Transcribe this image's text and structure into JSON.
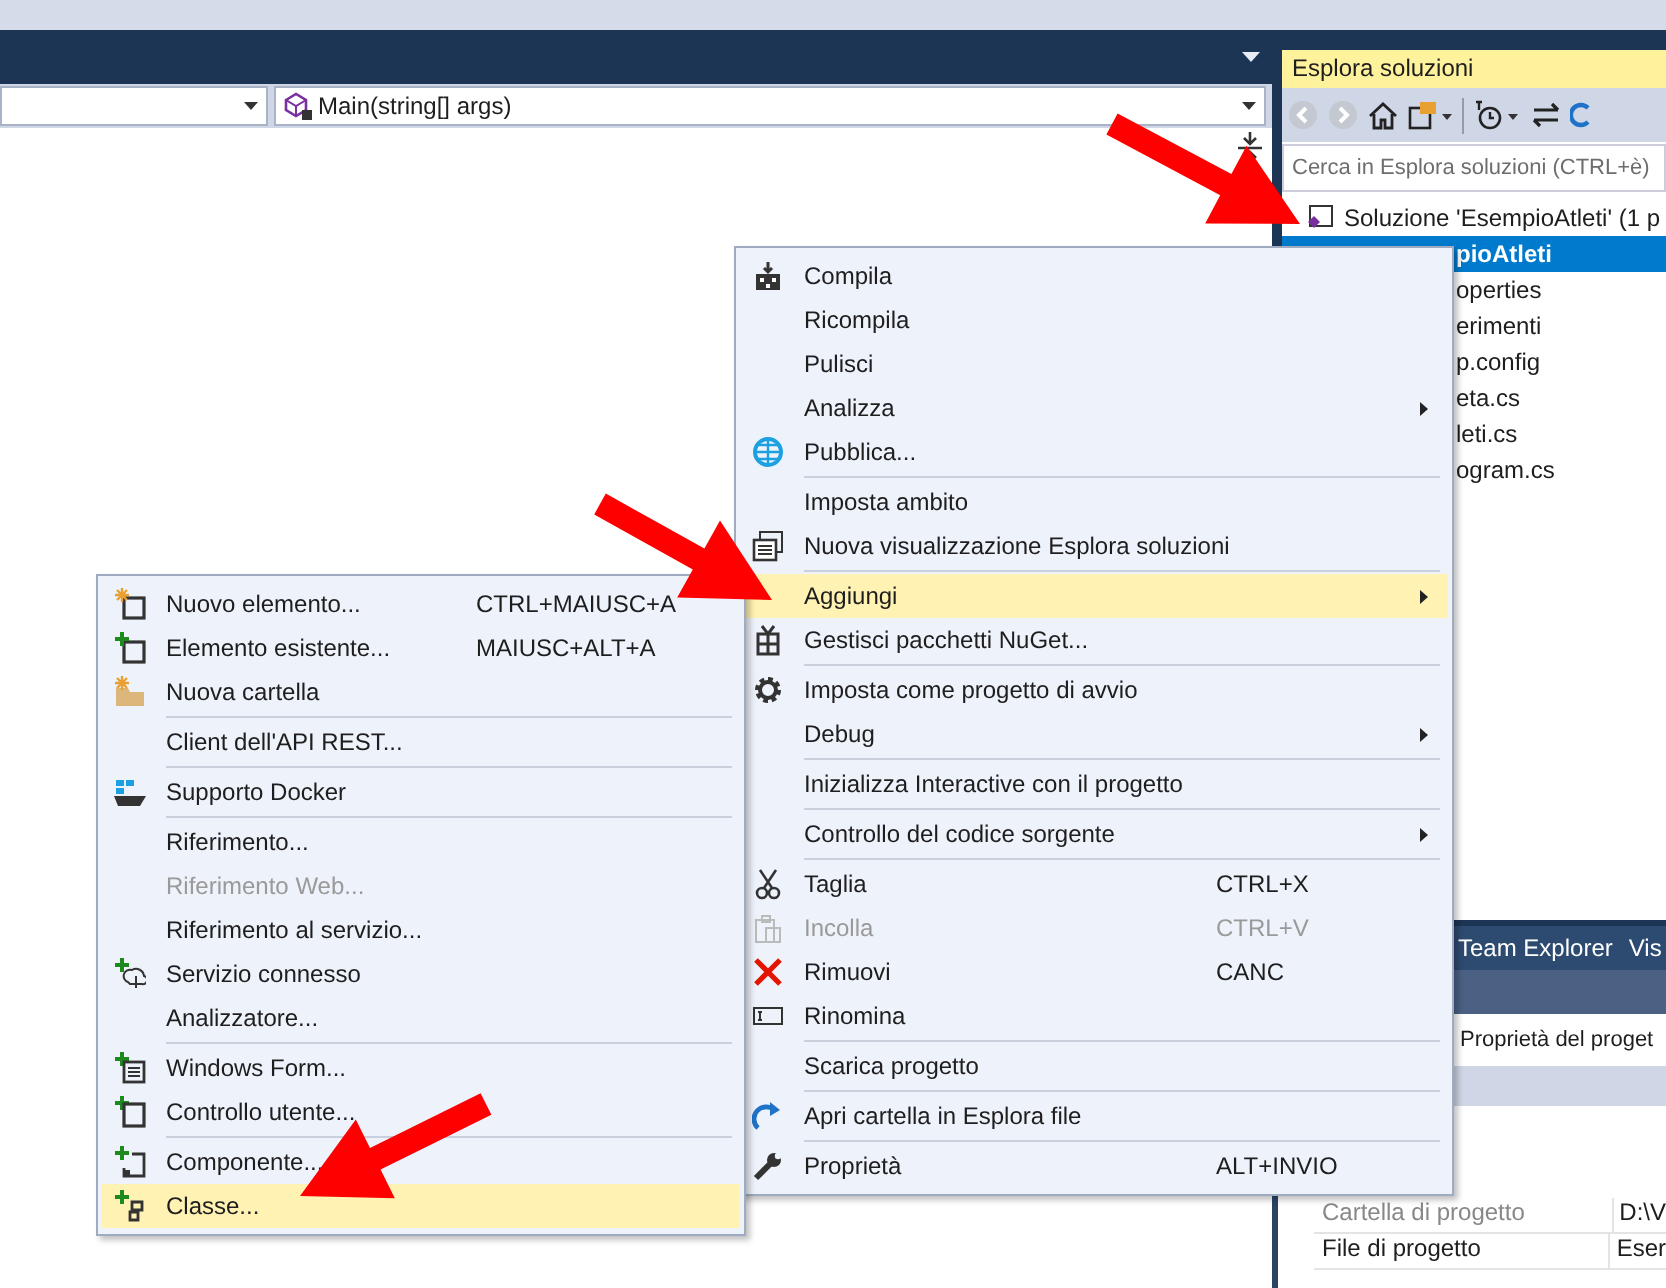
{
  "editor": {
    "member_dropdown": "Main(string[] args)"
  },
  "solution_explorer": {
    "title": "Esplora soluzioni",
    "search": {
      "placeholder": "Cerca in Esplora soluzioni (CTRL+è)"
    },
    "tree": [
      {
        "label": "Soluzione 'EsempioAtleti'  (1 p",
        "selected": false,
        "children": [
          {
            "label": "pioAtleti",
            "selected": true,
            "children": [
              {
                "label": "operties",
                "selected": false
              },
              {
                "label": "erimenti",
                "selected": false
              },
              {
                "label": "p.config",
                "selected": false
              },
              {
                "label": "eta.cs",
                "selected": false
              },
              {
                "label": "leti.cs",
                "selected": false
              },
              {
                "label": "ogram.cs",
                "selected": false
              }
            ]
          }
        ]
      }
    ]
  },
  "properties_panel": {
    "tabs": [
      {
        "label": "Team Explorer"
      },
      {
        "label": "Vis"
      }
    ],
    "object": "Proprietà del proget",
    "rows": [
      {
        "name": "Cartella di progetto",
        "value": "D:\\V",
        "disabled": true
      },
      {
        "name": "File di progetto",
        "value": "Eser",
        "disabled": false
      }
    ]
  },
  "context_menu": {
    "sections": [
      [
        {
          "label": "Compila",
          "submenu": false,
          "disabled": false,
          "selected": false
        },
        {
          "label": "Ricompila",
          "submenu": false,
          "disabled": false,
          "selected": false
        },
        {
          "label": "Pulisci",
          "submenu": false,
          "disabled": false,
          "selected": false
        },
        {
          "label": "Analizza",
          "submenu": true,
          "disabled": false,
          "selected": false
        },
        {
          "label": "Pubblica...",
          "submenu": false,
          "disabled": false,
          "selected": false
        }
      ],
      [
        {
          "label": "Imposta ambito",
          "submenu": false,
          "disabled": false,
          "selected": false
        },
        {
          "label": "Nuova visualizzazione Esplora soluzioni",
          "submenu": false,
          "disabled": false,
          "selected": false
        }
      ],
      [
        {
          "label": "Aggiungi",
          "submenu": true,
          "disabled": false,
          "selected": true
        },
        {
          "label": "Gestisci pacchetti NuGet...",
          "submenu": false,
          "disabled": false,
          "selected": false
        }
      ],
      [
        {
          "label": "Imposta come progetto di avvio",
          "submenu": false,
          "disabled": false,
          "selected": false
        },
        {
          "label": "Debug",
          "submenu": true,
          "disabled": false,
          "selected": false
        }
      ],
      [
        {
          "label": "Inizializza Interactive con il progetto",
          "submenu": false,
          "disabled": false,
          "selected": false
        }
      ],
      [
        {
          "label": "Controllo del codice sorgente",
          "submenu": true,
          "disabled": false,
          "selected": false
        }
      ],
      [
        {
          "label": "Taglia",
          "shortcut": "CTRL+X",
          "submenu": false,
          "disabled": false,
          "selected": false
        },
        {
          "label": "Incolla",
          "shortcut": "CTRL+V",
          "submenu": false,
          "disabled": true,
          "selected": false
        },
        {
          "label": "Rimuovi",
          "shortcut": "CANC",
          "submenu": false,
          "disabled": false,
          "selected": false
        },
        {
          "label": "Rinomina",
          "submenu": false,
          "disabled": false,
          "selected": false
        }
      ],
      [
        {
          "label": "Scarica progetto",
          "submenu": false,
          "disabled": false,
          "selected": false
        }
      ],
      [
        {
          "label": "Apri cartella in Esplora file",
          "submenu": false,
          "disabled": false,
          "selected": false
        }
      ],
      [
        {
          "label": "Proprietà",
          "shortcut": "ALT+INVIO",
          "submenu": false,
          "disabled": false,
          "selected": false
        }
      ]
    ]
  },
  "add_submenu": {
    "sections": [
      [
        {
          "label": "Nuovo elemento...",
          "shortcut": "CTRL+MAIUSC+A",
          "disabled": false,
          "selected": false
        },
        {
          "label": "Elemento esistente...",
          "shortcut": "MAIUSC+ALT+A",
          "disabled": false,
          "selected": false
        },
        {
          "label": "Nuova cartella",
          "disabled": false,
          "selected": false
        }
      ],
      [
        {
          "label": "Client dell'API REST...",
          "disabled": false,
          "selected": false
        }
      ],
      [
        {
          "label": "Supporto Docker",
          "disabled": false,
          "selected": false
        }
      ],
      [
        {
          "label": "Riferimento...",
          "disabled": false,
          "selected": false
        },
        {
          "label": "Riferimento Web...",
          "disabled": true,
          "selected": false
        },
        {
          "label": "Riferimento al servizio...",
          "disabled": false,
          "selected": false
        },
        {
          "label": "Servizio connesso",
          "disabled": false,
          "selected": false
        },
        {
          "label": "Analizzatore...",
          "disabled": false,
          "selected": false
        }
      ],
      [
        {
          "label": "Windows Form...",
          "disabled": false,
          "selected": false
        },
        {
          "label": "Controllo utente...",
          "disabled": false,
          "selected": false
        }
      ],
      [
        {
          "label": "Componente...",
          "disabled": false,
          "selected": false
        },
        {
          "label": "Classe...",
          "disabled": false,
          "selected": true
        }
      ]
    ]
  }
}
